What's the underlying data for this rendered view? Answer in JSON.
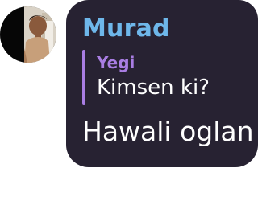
{
  "message": {
    "sender": "Murad",
    "reply": {
      "author": "Yegi",
      "text": "Kimsen ki?"
    },
    "text": "Hawali oglan"
  },
  "colors": {
    "bubble": "#272232",
    "sender": "#6eb7ea",
    "reply_accent": "#a97ee3",
    "text": "#ffffff"
  }
}
